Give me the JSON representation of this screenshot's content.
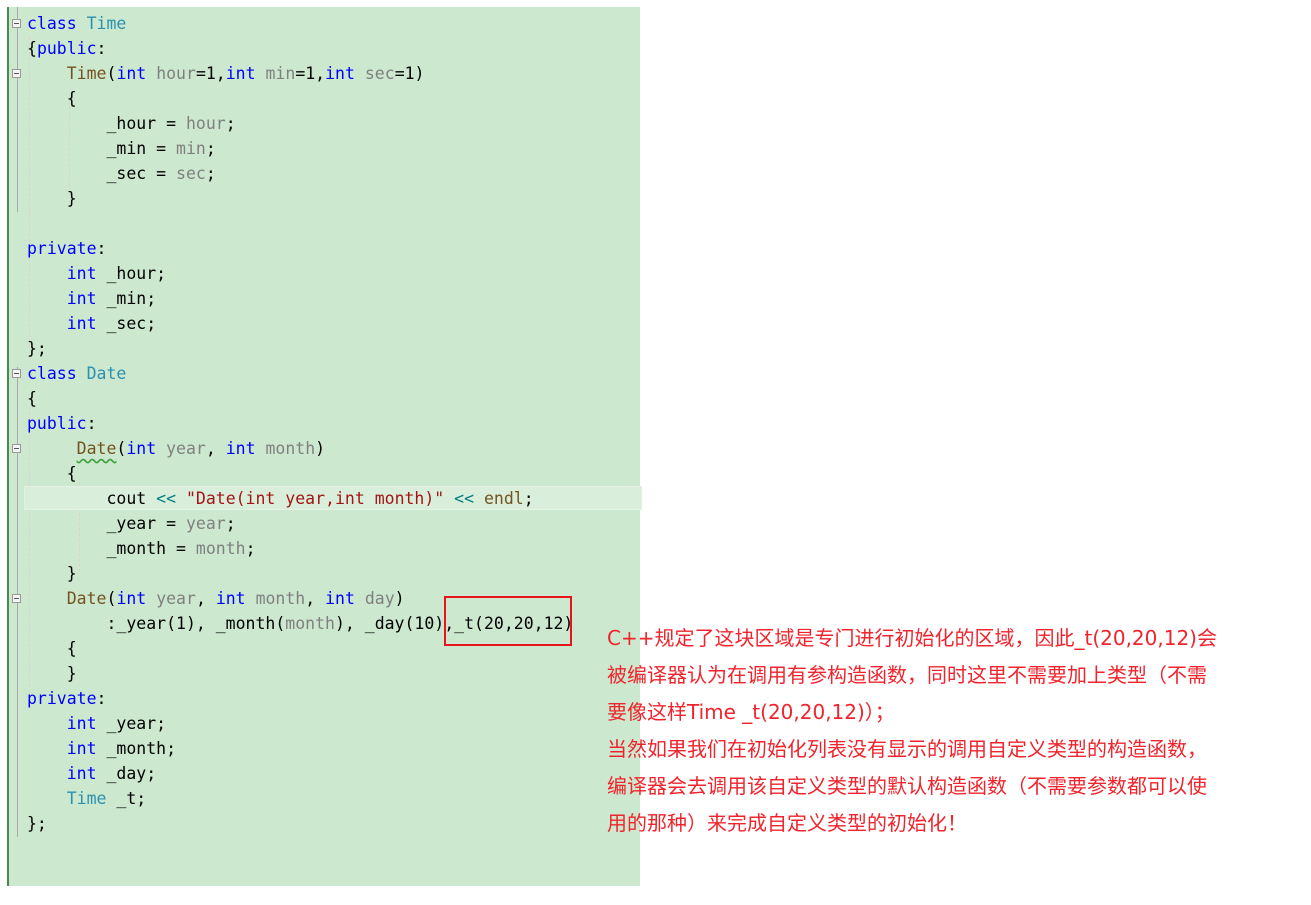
{
  "code_lines": [
    [
      [
        "class ",
        "kw"
      ],
      [
        "Time",
        "ty"
      ]
    ],
    [
      [
        "{",
        ""
      ],
      [
        "public",
        "kw"
      ],
      [
        ":",
        ""
      ]
    ],
    [
      [
        "    ",
        ""
      ],
      [
        "Time",
        "fn"
      ],
      [
        "(",
        ""
      ],
      [
        "int",
        "kw"
      ],
      [
        " ",
        ""
      ],
      [
        "hour",
        "pa"
      ],
      [
        "=1,",
        ""
      ],
      [
        "int",
        "kw"
      ],
      [
        " ",
        ""
      ],
      [
        "min",
        "pa"
      ],
      [
        "=1,",
        ""
      ],
      [
        "int",
        "kw"
      ],
      [
        " ",
        ""
      ],
      [
        "sec",
        "pa"
      ],
      [
        "=1)",
        ""
      ]
    ],
    [
      [
        "    {",
        ""
      ]
    ],
    [
      [
        "        _hour = ",
        ""
      ],
      [
        "hour",
        "pa"
      ],
      [
        ";",
        ""
      ]
    ],
    [
      [
        "        _min = ",
        ""
      ],
      [
        "min",
        "pa"
      ],
      [
        ";",
        ""
      ]
    ],
    [
      [
        "        _sec = ",
        ""
      ],
      [
        "sec",
        "pa"
      ],
      [
        ";",
        ""
      ]
    ],
    [
      [
        "    }",
        ""
      ]
    ],
    [],
    [
      [
        "private",
        "kw"
      ],
      [
        ":",
        ""
      ]
    ],
    [
      [
        "    ",
        ""
      ],
      [
        "int",
        "kw"
      ],
      [
        " _hour;",
        ""
      ]
    ],
    [
      [
        "    ",
        ""
      ],
      [
        "int",
        "kw"
      ],
      [
        " _min;",
        ""
      ]
    ],
    [
      [
        "    ",
        ""
      ],
      [
        "int",
        "kw"
      ],
      [
        " _sec;",
        ""
      ]
    ],
    [
      [
        "};",
        ""
      ]
    ],
    [
      [
        "class ",
        "kw"
      ],
      [
        "Date",
        "ty"
      ]
    ],
    [
      [
        "{",
        ""
      ]
    ],
    [
      [
        "public",
        "kw"
      ],
      [
        ":",
        ""
      ]
    ],
    [
      [
        "     ",
        ""
      ],
      [
        "Date",
        "fn squig"
      ],
      [
        "(",
        ""
      ],
      [
        "int",
        "kw"
      ],
      [
        " ",
        ""
      ],
      [
        "year",
        "pa"
      ],
      [
        ", ",
        ""
      ],
      [
        "int",
        "kw"
      ],
      [
        " ",
        ""
      ],
      [
        "month",
        "pa"
      ],
      [
        ")",
        ""
      ]
    ],
    [
      [
        "    {",
        ""
      ]
    ],
    [
      [
        "        cout ",
        ""
      ],
      [
        "<<",
        "op"
      ],
      [
        " ",
        ""
      ],
      [
        "\"Date(int year,int month)\"",
        "st"
      ],
      [
        " ",
        ""
      ],
      [
        "<<",
        "op"
      ],
      [
        " ",
        ""
      ],
      [
        "endl",
        "fn"
      ],
      [
        ";",
        ""
      ]
    ],
    [
      [
        "        _year = ",
        ""
      ],
      [
        "year",
        "pa"
      ],
      [
        ";",
        ""
      ]
    ],
    [
      [
        "        _month = ",
        ""
      ],
      [
        "month",
        "pa"
      ],
      [
        ";",
        ""
      ]
    ],
    [
      [
        "    }",
        ""
      ]
    ],
    [
      [
        "    ",
        ""
      ],
      [
        "Date",
        "fn"
      ],
      [
        "(",
        ""
      ],
      [
        "int",
        "kw"
      ],
      [
        " ",
        ""
      ],
      [
        "year",
        "pa"
      ],
      [
        ", ",
        ""
      ],
      [
        "int",
        "kw"
      ],
      [
        " ",
        ""
      ],
      [
        "month",
        "pa"
      ],
      [
        ", ",
        ""
      ],
      [
        "int",
        "kw"
      ],
      [
        " ",
        ""
      ],
      [
        "day",
        "pa"
      ],
      [
        ")",
        ""
      ]
    ],
    [
      [
        "        :_year(1), _month(",
        ""
      ],
      [
        "month",
        "pa"
      ],
      [
        "), _day(10),_t(20,20,12)",
        ""
      ]
    ],
    [
      [
        "    {",
        ""
      ]
    ],
    [
      [
        "    }",
        ""
      ]
    ],
    [
      [
        "private",
        "kw"
      ],
      [
        ":",
        ""
      ]
    ],
    [
      [
        "    ",
        ""
      ],
      [
        "int",
        "kw"
      ],
      [
        " _year;",
        ""
      ]
    ],
    [
      [
        "    ",
        ""
      ],
      [
        "int",
        "kw"
      ],
      [
        " _month;",
        ""
      ]
    ],
    [
      [
        "    ",
        ""
      ],
      [
        "int",
        "kw"
      ],
      [
        " _day;",
        ""
      ]
    ],
    [
      [
        "    ",
        ""
      ],
      [
        "Time",
        "ty"
      ],
      [
        " _t;",
        ""
      ]
    ],
    [
      [
        "};",
        ""
      ]
    ]
  ],
  "highlighted_line": 19,
  "fold_lines": [
    0,
    2,
    14,
    17,
    23
  ],
  "annotation": {
    "lines": [
      "C++规定了这块区域是专门进行初始化的区域，因此_t(20,20,12)会",
      "被编译器认为在调用有参构造函数，同时这里不需要加上类型（不需",
      "要像这样Time _t(20,20,12)）；",
      "当然如果我们在初始化列表没有显示的调用自定义类型的构造函数，",
      "编译器会去调用该自定义类型的默认构造函数（不需要参数都可以使",
      "用的那种）来完成自定义类型的初始化！"
    ]
  },
  "colors": {
    "background": "#cce8cf",
    "keyword": "#0000ff",
    "type": "#2b91af",
    "parameter": "#808080",
    "string": "#a31515",
    "annotation": "#f0242c",
    "highlight_box": "#e8141c"
  }
}
